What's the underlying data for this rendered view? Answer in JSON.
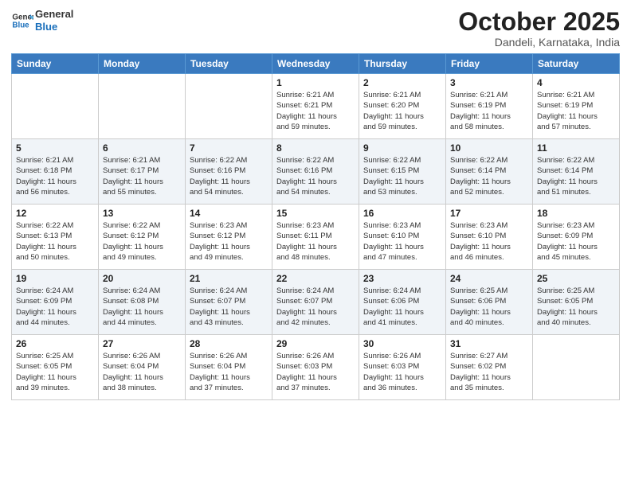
{
  "header": {
    "logo_general": "General",
    "logo_blue": "Blue",
    "month_title": "October 2025",
    "subtitle": "Dandeli, Karnataka, India"
  },
  "weekdays": [
    "Sunday",
    "Monday",
    "Tuesday",
    "Wednesday",
    "Thursday",
    "Friday",
    "Saturday"
  ],
  "weeks": [
    [
      {
        "day": "",
        "info": ""
      },
      {
        "day": "",
        "info": ""
      },
      {
        "day": "",
        "info": ""
      },
      {
        "day": "1",
        "info": "Sunrise: 6:21 AM\nSunset: 6:21 PM\nDaylight: 11 hours\nand 59 minutes."
      },
      {
        "day": "2",
        "info": "Sunrise: 6:21 AM\nSunset: 6:20 PM\nDaylight: 11 hours\nand 59 minutes."
      },
      {
        "day": "3",
        "info": "Sunrise: 6:21 AM\nSunset: 6:19 PM\nDaylight: 11 hours\nand 58 minutes."
      },
      {
        "day": "4",
        "info": "Sunrise: 6:21 AM\nSunset: 6:19 PM\nDaylight: 11 hours\nand 57 minutes."
      }
    ],
    [
      {
        "day": "5",
        "info": "Sunrise: 6:21 AM\nSunset: 6:18 PM\nDaylight: 11 hours\nand 56 minutes."
      },
      {
        "day": "6",
        "info": "Sunrise: 6:21 AM\nSunset: 6:17 PM\nDaylight: 11 hours\nand 55 minutes."
      },
      {
        "day": "7",
        "info": "Sunrise: 6:22 AM\nSunset: 6:16 PM\nDaylight: 11 hours\nand 54 minutes."
      },
      {
        "day": "8",
        "info": "Sunrise: 6:22 AM\nSunset: 6:16 PM\nDaylight: 11 hours\nand 54 minutes."
      },
      {
        "day": "9",
        "info": "Sunrise: 6:22 AM\nSunset: 6:15 PM\nDaylight: 11 hours\nand 53 minutes."
      },
      {
        "day": "10",
        "info": "Sunrise: 6:22 AM\nSunset: 6:14 PM\nDaylight: 11 hours\nand 52 minutes."
      },
      {
        "day": "11",
        "info": "Sunrise: 6:22 AM\nSunset: 6:14 PM\nDaylight: 11 hours\nand 51 minutes."
      }
    ],
    [
      {
        "day": "12",
        "info": "Sunrise: 6:22 AM\nSunset: 6:13 PM\nDaylight: 11 hours\nand 50 minutes."
      },
      {
        "day": "13",
        "info": "Sunrise: 6:22 AM\nSunset: 6:12 PM\nDaylight: 11 hours\nand 49 minutes."
      },
      {
        "day": "14",
        "info": "Sunrise: 6:23 AM\nSunset: 6:12 PM\nDaylight: 11 hours\nand 49 minutes."
      },
      {
        "day": "15",
        "info": "Sunrise: 6:23 AM\nSunset: 6:11 PM\nDaylight: 11 hours\nand 48 minutes."
      },
      {
        "day": "16",
        "info": "Sunrise: 6:23 AM\nSunset: 6:10 PM\nDaylight: 11 hours\nand 47 minutes."
      },
      {
        "day": "17",
        "info": "Sunrise: 6:23 AM\nSunset: 6:10 PM\nDaylight: 11 hours\nand 46 minutes."
      },
      {
        "day": "18",
        "info": "Sunrise: 6:23 AM\nSunset: 6:09 PM\nDaylight: 11 hours\nand 45 minutes."
      }
    ],
    [
      {
        "day": "19",
        "info": "Sunrise: 6:24 AM\nSunset: 6:09 PM\nDaylight: 11 hours\nand 44 minutes."
      },
      {
        "day": "20",
        "info": "Sunrise: 6:24 AM\nSunset: 6:08 PM\nDaylight: 11 hours\nand 44 minutes."
      },
      {
        "day": "21",
        "info": "Sunrise: 6:24 AM\nSunset: 6:07 PM\nDaylight: 11 hours\nand 43 minutes."
      },
      {
        "day": "22",
        "info": "Sunrise: 6:24 AM\nSunset: 6:07 PM\nDaylight: 11 hours\nand 42 minutes."
      },
      {
        "day": "23",
        "info": "Sunrise: 6:24 AM\nSunset: 6:06 PM\nDaylight: 11 hours\nand 41 minutes."
      },
      {
        "day": "24",
        "info": "Sunrise: 6:25 AM\nSunset: 6:06 PM\nDaylight: 11 hours\nand 40 minutes."
      },
      {
        "day": "25",
        "info": "Sunrise: 6:25 AM\nSunset: 6:05 PM\nDaylight: 11 hours\nand 40 minutes."
      }
    ],
    [
      {
        "day": "26",
        "info": "Sunrise: 6:25 AM\nSunset: 6:05 PM\nDaylight: 11 hours\nand 39 minutes."
      },
      {
        "day": "27",
        "info": "Sunrise: 6:26 AM\nSunset: 6:04 PM\nDaylight: 11 hours\nand 38 minutes."
      },
      {
        "day": "28",
        "info": "Sunrise: 6:26 AM\nSunset: 6:04 PM\nDaylight: 11 hours\nand 37 minutes."
      },
      {
        "day": "29",
        "info": "Sunrise: 6:26 AM\nSunset: 6:03 PM\nDaylight: 11 hours\nand 37 minutes."
      },
      {
        "day": "30",
        "info": "Sunrise: 6:26 AM\nSunset: 6:03 PM\nDaylight: 11 hours\nand 36 minutes."
      },
      {
        "day": "31",
        "info": "Sunrise: 6:27 AM\nSunset: 6:02 PM\nDaylight: 11 hours\nand 35 minutes."
      },
      {
        "day": "",
        "info": ""
      }
    ]
  ]
}
